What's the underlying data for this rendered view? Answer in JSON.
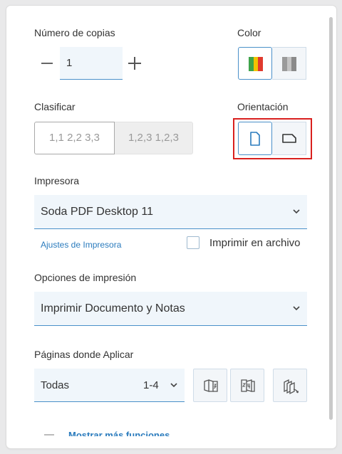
{
  "copies": {
    "label": "Número de copias",
    "value": "1"
  },
  "color": {
    "label": "Color"
  },
  "collate": {
    "label": "Clasificar",
    "options": [
      "1,1 2,2 3,3",
      "1,2,3 1,2,3"
    ]
  },
  "orientation": {
    "label": "Orientación"
  },
  "printer": {
    "label": "Impresora",
    "selected": "Soda PDF Desktop 11",
    "settings_link": "Ajustes de Impresora",
    "print_to_file_label": "Imprimir en archivo"
  },
  "print_options": {
    "label": "Opciones de impresión",
    "selected": "Imprimir Documento y Notas"
  },
  "pages": {
    "label": "Páginas donde Aplicar",
    "selected": "Todas",
    "range": "1-4"
  },
  "more": {
    "label": "Mostrar más funciones"
  },
  "colors": {
    "accent": "#4a90c9",
    "highlight": "#d9201e",
    "field_bg": "#f0f6fb",
    "stripe_green": "#3ea34a",
    "stripe_yellow": "#f2c200",
    "stripe_red": "#e03a2e"
  },
  "icons": [
    "minus-icon",
    "plus-icon",
    "color-stripes-icon",
    "grayscale-stripes-icon",
    "portrait-page-icon",
    "landscape-page-icon",
    "chevron-down-icon",
    "page-order-icon",
    "reverse-order-icon",
    "multi-page-icon"
  ]
}
